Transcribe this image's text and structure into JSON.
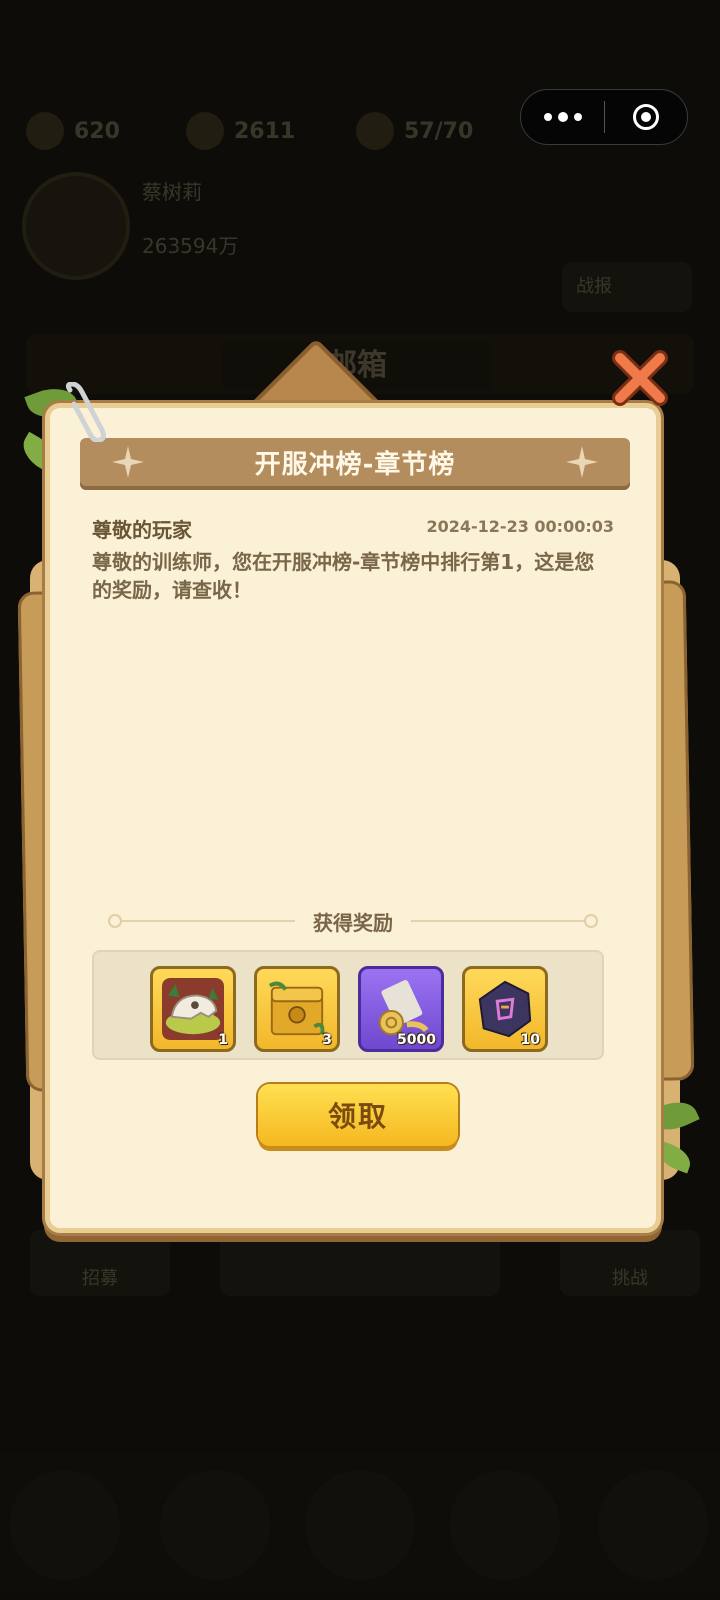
{
  "background": {
    "stats": [
      "620",
      "2611",
      "57/70"
    ],
    "player_name": "蔡树莉",
    "power": "263594万",
    "side_button": "战报",
    "mail_header": "邮箱",
    "bottom_buttons": [
      "招募",
      "",
      "挑战"
    ]
  },
  "capsule": {
    "more_icon": "more-dots-icon",
    "close_icon": "target-close-icon"
  },
  "mail": {
    "title": "开服冲榜-章节榜",
    "sender": "尊敬的玩家",
    "date": "2024-12-23 00:00:03",
    "body": "尊敬的训练师，您在开服冲榜-章节榜中排行第1，这是您的奖励，请查收！",
    "reward_header": "获得奖励",
    "rewards": [
      {
        "name": "dinosaur-skull-icon",
        "qty": "1",
        "frame": "gold"
      },
      {
        "name": "treasure-chest-icon",
        "qty": "3",
        "frame": "gold"
      },
      {
        "name": "scroll-icon",
        "qty": "5000",
        "frame": "purple"
      },
      {
        "name": "rune-stone-icon",
        "qty": "10",
        "frame": "gold"
      }
    ],
    "claim_label": "领取"
  },
  "colors": {
    "paper": "#fbf1d7",
    "banner": "#b38d5e",
    "button": "#f5b820",
    "close": "#f07a4a"
  }
}
